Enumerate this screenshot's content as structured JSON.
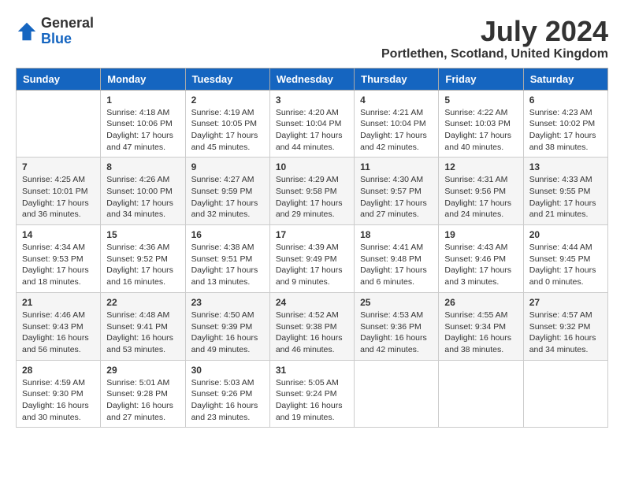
{
  "logo": {
    "general": "General",
    "blue": "Blue"
  },
  "title": "July 2024",
  "location": "Portlethen, Scotland, United Kingdom",
  "days_header": [
    "Sunday",
    "Monday",
    "Tuesday",
    "Wednesday",
    "Thursday",
    "Friday",
    "Saturday"
  ],
  "weeks": [
    [
      {
        "day": "",
        "content": ""
      },
      {
        "day": "1",
        "content": "Sunrise: 4:18 AM\nSunset: 10:06 PM\nDaylight: 17 hours\nand 47 minutes."
      },
      {
        "day": "2",
        "content": "Sunrise: 4:19 AM\nSunset: 10:05 PM\nDaylight: 17 hours\nand 45 minutes."
      },
      {
        "day": "3",
        "content": "Sunrise: 4:20 AM\nSunset: 10:04 PM\nDaylight: 17 hours\nand 44 minutes."
      },
      {
        "day": "4",
        "content": "Sunrise: 4:21 AM\nSunset: 10:04 PM\nDaylight: 17 hours\nand 42 minutes."
      },
      {
        "day": "5",
        "content": "Sunrise: 4:22 AM\nSunset: 10:03 PM\nDaylight: 17 hours\nand 40 minutes."
      },
      {
        "day": "6",
        "content": "Sunrise: 4:23 AM\nSunset: 10:02 PM\nDaylight: 17 hours\nand 38 minutes."
      }
    ],
    [
      {
        "day": "7",
        "content": "Sunrise: 4:25 AM\nSunset: 10:01 PM\nDaylight: 17 hours\nand 36 minutes."
      },
      {
        "day": "8",
        "content": "Sunrise: 4:26 AM\nSunset: 10:00 PM\nDaylight: 17 hours\nand 34 minutes."
      },
      {
        "day": "9",
        "content": "Sunrise: 4:27 AM\nSunset: 9:59 PM\nDaylight: 17 hours\nand 32 minutes."
      },
      {
        "day": "10",
        "content": "Sunrise: 4:29 AM\nSunset: 9:58 PM\nDaylight: 17 hours\nand 29 minutes."
      },
      {
        "day": "11",
        "content": "Sunrise: 4:30 AM\nSunset: 9:57 PM\nDaylight: 17 hours\nand 27 minutes."
      },
      {
        "day": "12",
        "content": "Sunrise: 4:31 AM\nSunset: 9:56 PM\nDaylight: 17 hours\nand 24 minutes."
      },
      {
        "day": "13",
        "content": "Sunrise: 4:33 AM\nSunset: 9:55 PM\nDaylight: 17 hours\nand 21 minutes."
      }
    ],
    [
      {
        "day": "14",
        "content": "Sunrise: 4:34 AM\nSunset: 9:53 PM\nDaylight: 17 hours\nand 18 minutes."
      },
      {
        "day": "15",
        "content": "Sunrise: 4:36 AM\nSunset: 9:52 PM\nDaylight: 17 hours\nand 16 minutes."
      },
      {
        "day": "16",
        "content": "Sunrise: 4:38 AM\nSunset: 9:51 PM\nDaylight: 17 hours\nand 13 minutes."
      },
      {
        "day": "17",
        "content": "Sunrise: 4:39 AM\nSunset: 9:49 PM\nDaylight: 17 hours\nand 9 minutes."
      },
      {
        "day": "18",
        "content": "Sunrise: 4:41 AM\nSunset: 9:48 PM\nDaylight: 17 hours\nand 6 minutes."
      },
      {
        "day": "19",
        "content": "Sunrise: 4:43 AM\nSunset: 9:46 PM\nDaylight: 17 hours\nand 3 minutes."
      },
      {
        "day": "20",
        "content": "Sunrise: 4:44 AM\nSunset: 9:45 PM\nDaylight: 17 hours\nand 0 minutes."
      }
    ],
    [
      {
        "day": "21",
        "content": "Sunrise: 4:46 AM\nSunset: 9:43 PM\nDaylight: 16 hours\nand 56 minutes."
      },
      {
        "day": "22",
        "content": "Sunrise: 4:48 AM\nSunset: 9:41 PM\nDaylight: 16 hours\nand 53 minutes."
      },
      {
        "day": "23",
        "content": "Sunrise: 4:50 AM\nSunset: 9:39 PM\nDaylight: 16 hours\nand 49 minutes."
      },
      {
        "day": "24",
        "content": "Sunrise: 4:52 AM\nSunset: 9:38 PM\nDaylight: 16 hours\nand 46 minutes."
      },
      {
        "day": "25",
        "content": "Sunrise: 4:53 AM\nSunset: 9:36 PM\nDaylight: 16 hours\nand 42 minutes."
      },
      {
        "day": "26",
        "content": "Sunrise: 4:55 AM\nSunset: 9:34 PM\nDaylight: 16 hours\nand 38 minutes."
      },
      {
        "day": "27",
        "content": "Sunrise: 4:57 AM\nSunset: 9:32 PM\nDaylight: 16 hours\nand 34 minutes."
      }
    ],
    [
      {
        "day": "28",
        "content": "Sunrise: 4:59 AM\nSunset: 9:30 PM\nDaylight: 16 hours\nand 30 minutes."
      },
      {
        "day": "29",
        "content": "Sunrise: 5:01 AM\nSunset: 9:28 PM\nDaylight: 16 hours\nand 27 minutes."
      },
      {
        "day": "30",
        "content": "Sunrise: 5:03 AM\nSunset: 9:26 PM\nDaylight: 16 hours\nand 23 minutes."
      },
      {
        "day": "31",
        "content": "Sunrise: 5:05 AM\nSunset: 9:24 PM\nDaylight: 16 hours\nand 19 minutes."
      },
      {
        "day": "",
        "content": ""
      },
      {
        "day": "",
        "content": ""
      },
      {
        "day": "",
        "content": ""
      }
    ]
  ]
}
